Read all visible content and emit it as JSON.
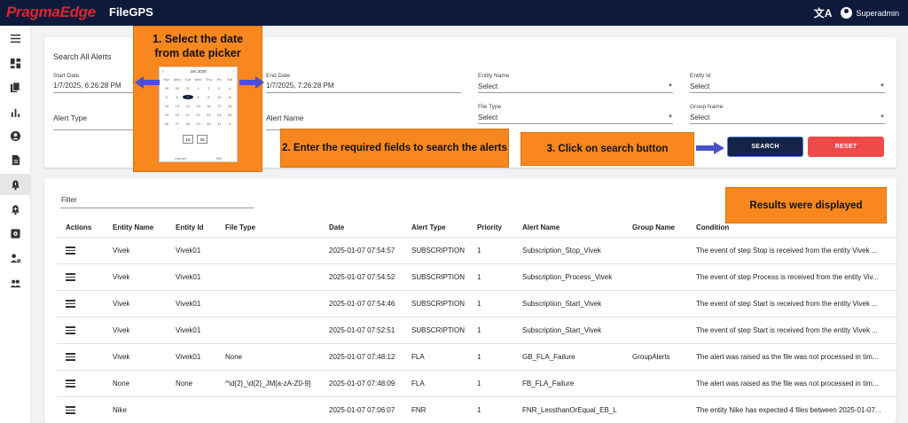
{
  "header": {
    "brand": "PragmaEdge",
    "app_name": "FileGPS",
    "translate_glyph": "文A",
    "user": "Superadmin"
  },
  "sidebar": {
    "icons": [
      "menu-icon",
      "dashboard-icon",
      "files-icon",
      "chart-icon",
      "account-icon",
      "document-icon",
      "alert-icon",
      "alert-settings-icon",
      "settings-box-icon",
      "user-settings-icon",
      "group-icon"
    ],
    "active_index": 6
  },
  "search": {
    "title": "Search All Alerts",
    "start_date_label": "Start Date",
    "start_date_value": "1/7/2025, 6:26:28 PM",
    "end_date_label": "End Date",
    "end_date_value": "1/7/2025, 7:26:28 PM",
    "entity_name_label": "Entity Name",
    "entity_name_value": "Select",
    "entity_id_label": "Entity Id",
    "entity_id_value": "Select",
    "alert_type_label": "Alert Type",
    "alert_name_label": "Alert Name",
    "file_type_label": "File Type",
    "file_type_value": "Select",
    "group_name_label": "Group Name",
    "group_name_value": "Select",
    "search_button": "SEARCH",
    "reset_button": "RESET"
  },
  "datepicker": {
    "month": "Jan 2025",
    "weekdays": [
      "Sun",
      "Mon",
      "Tue",
      "Wed",
      "Thu",
      "Fri",
      "Sat"
    ],
    "days": [
      "29",
      "30",
      "31",
      "1",
      "2",
      "3",
      "4",
      "5",
      "6",
      "7",
      "8",
      "9",
      "10",
      "11",
      "12",
      "13",
      "14",
      "15",
      "16",
      "17",
      "18",
      "19",
      "20",
      "21",
      "22",
      "23",
      "24",
      "25",
      "26",
      "27",
      "28",
      "29",
      "30",
      "31",
      "1"
    ],
    "selected_day": "7",
    "hour": "18",
    "minute": "26",
    "cancel": "Cancel",
    "set": "Set"
  },
  "callouts": {
    "step1": "1. Select the date from date picker",
    "step2": "2. Enter the required fields to search the alerts",
    "step3": "3. Click on search button",
    "results": "Results were displayed"
  },
  "results": {
    "filter_label": "Filter",
    "columns": [
      "Actions",
      "Entity Name",
      "Entity Id",
      "File Type",
      "Date",
      "Alert Type",
      "Priority",
      "Alert Name",
      "Group Name",
      "Condition"
    ],
    "rows": [
      [
        "",
        "Vivek",
        "Vivek01",
        "",
        "2025-01-07 07:54:57",
        "SUBSCRIPTION",
        "1",
        "Subscription_Stop_Vivek",
        "",
        "The event of step Stop is received from the entity Vivek ..."
      ],
      [
        "",
        "Vivek",
        "Vivek01",
        "",
        "2025-01-07 07:54:52",
        "SUBSCRIPTION",
        "1",
        "Subscription_Process_Vivek",
        "",
        "The event of step Process is received from the entity Viv..."
      ],
      [
        "",
        "Vivek",
        "Vivek01",
        "",
        "2025-01-07 07:54:46",
        "SUBSCRIPTION",
        "1",
        "Subscription_Start_Vivek",
        "",
        "The event of step Start is received from the entity Vivek ..."
      ],
      [
        "",
        "Vivek",
        "Vivek01",
        "",
        "2025-01-07 07:52:51",
        "SUBSCRIPTION",
        "1",
        "Subscription_Start_Vivek",
        "",
        "The event of step Start is received from the entity Vivek ..."
      ],
      [
        "",
        "Vivek",
        "Vivek01",
        "None",
        "2025-01-07 07:48:12",
        "FLA",
        "1",
        "GB_FLA_Failure",
        "GroupAlerts",
        "The alert was raised as the file was not processed in tim..."
      ],
      [
        "",
        "None",
        "None",
        "^\\d{2}_\\d{2}_JM[a-zA-Z0-9]",
        "2025-01-07 07:48:09",
        "FLA",
        "1",
        "FB_FLA_Failure",
        "",
        "The alert was raised as the file was not processed in tim..."
      ],
      [
        "",
        "Nike",
        "",
        "",
        "2025-01-07 07:06:07",
        "FNR",
        "1",
        "FNR_LessthanOrEqual_EB_L",
        "",
        "The entity Nike has expected 4 files between 2025-01-07..."
      ]
    ]
  },
  "colors": {
    "topbar": "#0e1a3c",
    "brand": "#e0242b",
    "callout": "#f7871e",
    "search_button": "#132446",
    "reset_button": "#ef4a4a",
    "arrow": "#4b4fc9"
  }
}
